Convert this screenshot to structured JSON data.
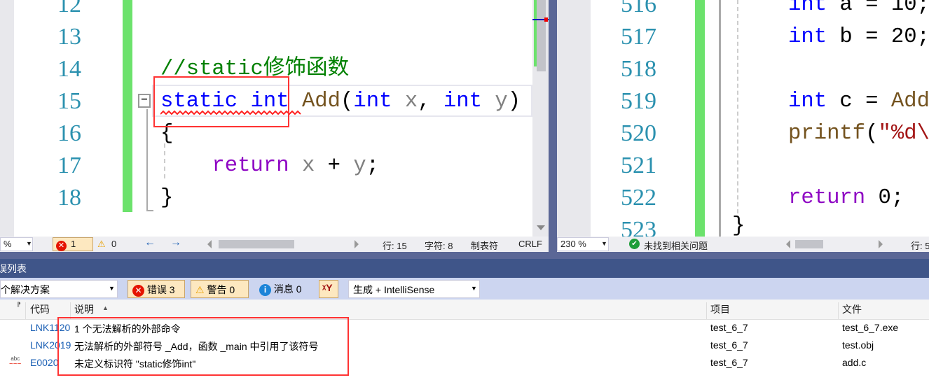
{
  "left_editor": {
    "line_numbers": [
      "12",
      "13",
      "14",
      "15",
      "16",
      "17",
      "18"
    ],
    "comment": "//static修饰函数",
    "line15": {
      "kw1": "static",
      "kw2": "int",
      "fn": "Add",
      "p1": "(",
      "kw3": "int",
      "x": "x",
      "comma": ",",
      "kw4": "int",
      "y": "y",
      "p2": ")"
    },
    "line16": "{",
    "line17": {
      "ret": "return",
      "expr_x": "x",
      "plus": "+",
      "expr_y": "y",
      "semi": ";"
    },
    "line18": "}",
    "fold_glyph": "−"
  },
  "right_editor": {
    "line_numbers": [
      "516",
      "517",
      "518",
      "519",
      "520",
      "521",
      "522",
      "523"
    ],
    "line516": {
      "kw": "int",
      "rest": " a = 10;"
    },
    "line517": {
      "kw": "int",
      "rest": " b = 20;"
    },
    "line519": {
      "kw": "int",
      "rest": " c = ",
      "fn": "Add"
    },
    "line520": {
      "fn": "printf",
      "paren": "(",
      "str": "\"%d\\"
    },
    "line522": {
      "ret": "return",
      "rest": " 0;"
    },
    "line523": "}"
  },
  "left_status": {
    "zoom": "%",
    "errors": "1",
    "warnings": "0",
    "line": "行: 15",
    "char": "字符: 8",
    "tabs": "制表符",
    "eol": "CRLF"
  },
  "right_status": {
    "zoom": "230 %",
    "no_issues": "未找到相关问题",
    "line": "行: 5"
  },
  "error_list": {
    "title": "误列表",
    "scope": "个解决方案",
    "errors_btn": "错误 3",
    "warnings_btn": "警告 0",
    "messages_btn": "消息 0",
    "build_filter": "生成 + IntelliSense",
    "columns": {
      "code": "代码",
      "desc": "说明",
      "project": "项目",
      "file": "文件"
    },
    "rows": [
      {
        "icon": "error",
        "code": "LNK1120",
        "desc": "1 个无法解析的外部命令",
        "project": "test_6_7",
        "file": "test_6_7.exe"
      },
      {
        "icon": "error",
        "code": "LNK2019",
        "desc": "无法解析的外部符号 _Add，函数 _main 中引用了该符号",
        "project": "test_6_7",
        "file": "test.obj"
      },
      {
        "icon": "intellisense",
        "code": "E0020",
        "desc": "未定义标识符 \"static修饰int\"",
        "project": "test_6_7",
        "file": "add.c"
      }
    ]
  },
  "colors": {
    "keyword": "#0000ff",
    "comment": "#008000",
    "function": "#74531f",
    "return": "#8f08c4",
    "line_number": "#2b91af",
    "change_bar": "#6ce26c",
    "highlight": "#ff3333",
    "panel_title": "#3f5589"
  }
}
